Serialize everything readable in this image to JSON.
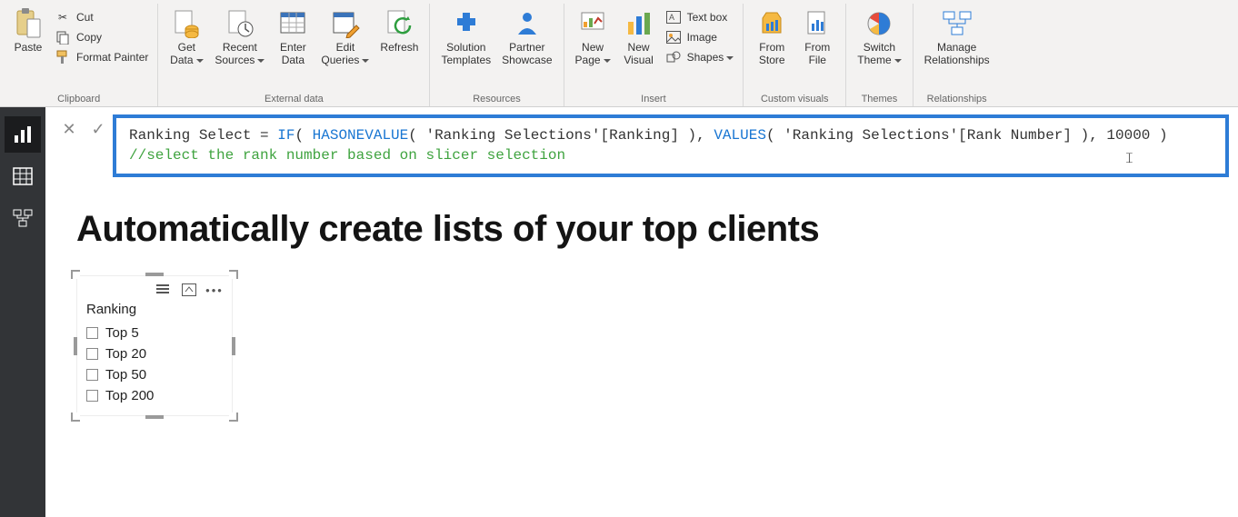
{
  "ribbon": {
    "clipboard": {
      "paste": "Paste",
      "cut": "Cut",
      "copy": "Copy",
      "format_painter": "Format Painter",
      "group_label": "Clipboard"
    },
    "external_data": {
      "get_data": "Get\nData",
      "recent_sources": "Recent\nSources",
      "enter_data": "Enter\nData",
      "edit_queries": "Edit\nQueries",
      "refresh": "Refresh",
      "group_label": "External data"
    },
    "resources": {
      "solution_templates": "Solution\nTemplates",
      "partner_showcase": "Partner\nShowcase",
      "group_label": "Resources"
    },
    "insert": {
      "new_page": "New\nPage",
      "new_visual": "New\nVisual",
      "text_box": "Text box",
      "image": "Image",
      "shapes": "Shapes",
      "group_label": "Insert"
    },
    "custom_visuals": {
      "from_store": "From\nStore",
      "from_file": "From\nFile",
      "group_label": "Custom visuals"
    },
    "themes": {
      "switch_theme": "Switch\nTheme",
      "group_label": "Themes"
    },
    "relationships": {
      "manage": "Manage\nRelationships",
      "group_label": "Relationships"
    }
  },
  "formula": {
    "prefix": "Ranking Select = ",
    "kw_if": "IF",
    "seg1": "( ",
    "kw_hasonevalue": "HASONEVALUE",
    "seg2": "( 'Ranking Selections'[Ranking] ), ",
    "kw_values": "VALUES",
    "seg3": "( 'Ranking Selections'[Rank Number] ), 10000 )",
    "comment": "//select the rank number based on slicer selection"
  },
  "canvas": {
    "title": "Automatically create lists of your top clients",
    "slicer": {
      "header": "Ranking",
      "items": [
        "Top 5",
        "Top 20",
        "Top 50",
        "Top 200"
      ]
    }
  }
}
